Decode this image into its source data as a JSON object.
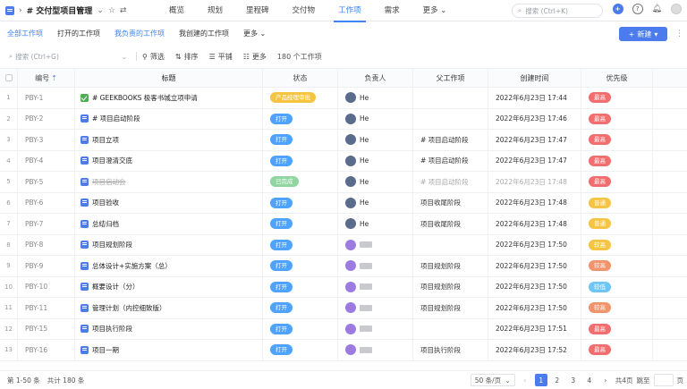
{
  "topbar": {
    "project_title": "# 交付型项目管理",
    "nav": [
      "概览",
      "规划",
      "里程碑",
      "交付物",
      "工作项",
      "需求",
      "更多"
    ],
    "active_nav": "工作项",
    "search_placeholder": "搜索 (Ctrl+K)"
  },
  "subbar": {
    "tabs": [
      "全部工作项",
      "打开的工作项",
      "我负责的工作项",
      "我创建的工作项",
      "更多"
    ],
    "new_button": "新建"
  },
  "filterbar": {
    "search_placeholder": "搜索 (Ctrl+G)",
    "filter": "筛选",
    "sort": "排序",
    "tile": "平铺",
    "more": "更多",
    "count": "180 个工作项"
  },
  "table": {
    "headers": {
      "id": "编号",
      "title": "标题",
      "status": "状态",
      "owner": "负责人",
      "parent": "父工作项",
      "created": "创建时间",
      "priority": "优先级"
    },
    "rows": [
      {
        "idx": "1",
        "id": "PBY-1",
        "icon": "done",
        "title": "# GEEKBOOKS 极客书城立项申请",
        "status": "产品经理审批",
        "status_color": "yellow",
        "owner": "He",
        "owner_type": "he",
        "parent": "",
        "created": "2022年6月23日 17:44",
        "priority": "最高",
        "prio_color": "high"
      },
      {
        "idx": "2",
        "id": "PBY-2",
        "icon": "milestone",
        "title": "# 项目启动阶段",
        "status": "打开",
        "status_color": "open",
        "owner": "He",
        "owner_type": "he",
        "parent": "",
        "created": "2022年6月23日 17:46",
        "priority": "最高",
        "prio_color": "high"
      },
      {
        "idx": "3",
        "id": "PBY-3",
        "icon": "task",
        "title": "项目立项",
        "status": "打开",
        "status_color": "open",
        "owner": "He",
        "owner_type": "he",
        "parent": "# 项目启动阶段",
        "created": "2022年6月23日 17:47",
        "priority": "最高",
        "prio_color": "high"
      },
      {
        "idx": "4",
        "id": "PBY-4",
        "icon": "task",
        "title": "项目澄清交底",
        "status": "打开",
        "status_color": "open",
        "owner": "He",
        "owner_type": "he",
        "parent": "# 项目启动阶段",
        "created": "2022年6月23日 17:47",
        "priority": "最高",
        "prio_color": "high"
      },
      {
        "idx": "5",
        "id": "PBY-5",
        "icon": "task",
        "title": "项目启动会",
        "status": "已完成",
        "status_color": "green",
        "owner": "He",
        "owner_type": "he",
        "parent": "# 项目启动阶段",
        "created": "2022年6月23日 17:48",
        "priority": "最高",
        "prio_color": "high",
        "muted": true
      },
      {
        "idx": "6",
        "id": "PBY-6",
        "icon": "task",
        "title": "项目验收",
        "status": "打开",
        "status_color": "open",
        "owner": "He",
        "owner_type": "he",
        "parent": "项目收尾阶段",
        "created": "2022年6月23日 17:48",
        "priority": "普通",
        "prio_color": "normal"
      },
      {
        "idx": "7",
        "id": "PBY-7",
        "icon": "task",
        "title": "总结归档",
        "status": "打开",
        "status_color": "open",
        "owner": "He",
        "owner_type": "he",
        "parent": "项目收尾阶段",
        "created": "2022年6月23日 17:48",
        "priority": "普通",
        "prio_color": "normal"
      },
      {
        "idx": "8",
        "id": "PBY-8",
        "icon": "task",
        "title": "项目规划阶段",
        "status": "打开",
        "status_color": "open",
        "owner": "",
        "owner_type": "multi",
        "parent": "",
        "created": "2022年6月23日 17:50",
        "priority": "较高",
        "prio_color": "normal"
      },
      {
        "idx": "9",
        "id": "PBY-9",
        "icon": "task",
        "title": "总体设计+实施方案（总）",
        "status": "打开",
        "status_color": "open",
        "owner": "",
        "owner_type": "multi",
        "parent": "项目规划阶段",
        "created": "2022年6月23日 17:50",
        "priority": "较高",
        "prio_color": "mid"
      },
      {
        "idx": "10",
        "id": "PBY-10",
        "icon": "task",
        "title": "概要设计（分）",
        "status": "打开",
        "status_color": "open",
        "owner": "",
        "owner_type": "multi",
        "parent": "项目规划阶段",
        "created": "2022年6月23日 17:50",
        "priority": "较低",
        "prio_color": "low"
      },
      {
        "idx": "11",
        "id": "PBY-11",
        "icon": "task",
        "title": "管理计划（内控细致版）",
        "status": "打开",
        "status_color": "open",
        "owner": "",
        "owner_type": "multi",
        "parent": "项目规划阶段",
        "created": "2022年6月23日 17:50",
        "priority": "较高",
        "prio_color": "mid"
      },
      {
        "idx": "12",
        "id": "PBY-15",
        "icon": "task",
        "title": "项目执行阶段",
        "status": "打开",
        "status_color": "open",
        "owner": "",
        "owner_type": "multi",
        "parent": "",
        "created": "2022年6月23日 17:51",
        "priority": "最高",
        "prio_color": "high"
      },
      {
        "idx": "13",
        "id": "PBY-16",
        "icon": "task",
        "title": "项目一期",
        "status": "打开",
        "status_color": "open",
        "owner": "",
        "owner_type": "multi",
        "parent": "项目执行阶段",
        "created": "2022年6月23日 17:52",
        "priority": "最高",
        "prio_color": "high"
      }
    ]
  },
  "footer": {
    "range": "第 1-50 条",
    "total": "共计 180 条",
    "page_size": "50 条/页",
    "pages": [
      "1",
      "2",
      "3",
      "4"
    ],
    "total_pages": "共4页",
    "jump": "跳至",
    "page_unit": "页"
  }
}
